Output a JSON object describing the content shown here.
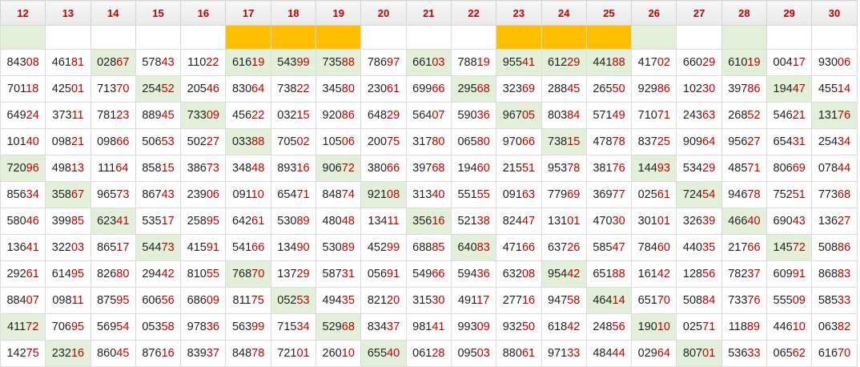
{
  "headers": [
    "12",
    "13",
    "14",
    "15",
    "16",
    "17",
    "18",
    "19",
    "20",
    "21",
    "22",
    "23",
    "24",
    "25",
    "26",
    "27",
    "28",
    "29",
    "30"
  ],
  "marker_row": [
    "green",
    "white",
    "white",
    "white",
    "white",
    "gold",
    "gold",
    "gold",
    "white",
    "white",
    "white",
    "gold",
    "gold",
    "gold",
    "green",
    "white",
    "green",
    "white",
    "white"
  ],
  "rows": [
    {
      "values": [
        "84308",
        "46181",
        "02867",
        "57843",
        "11022",
        "61619",
        "54399",
        "73588",
        "78697",
        "66103",
        "78819",
        "95541",
        "61229",
        "44188",
        "41702",
        "66029",
        "61019",
        "00417",
        "93006"
      ],
      "highlighted": [
        2,
        5,
        6,
        7,
        9,
        11,
        12,
        13,
        16
      ]
    },
    {
      "values": [
        "70118",
        "42501",
        "71370",
        "25452",
        "20546",
        "83064",
        "73822",
        "34580",
        "23061",
        "69966",
        "29568",
        "32369",
        "28845",
        "26550",
        "92986",
        "10230",
        "39786",
        "19447",
        "45514"
      ],
      "highlighted": [
        3,
        10,
        17
      ]
    },
    {
      "values": [
        "64924",
        "37311",
        "78123",
        "88945",
        "73309",
        "45622",
        "03215",
        "92086",
        "64829",
        "56407",
        "59036",
        "96705",
        "80384",
        "57149",
        "71071",
        "24363",
        "26852",
        "54621",
        "13176"
      ],
      "highlighted": [
        4,
        11,
        18
      ]
    },
    {
      "values": [
        "10140",
        "09821",
        "09866",
        "50653",
        "50227",
        "03388",
        "70502",
        "10506",
        "20075",
        "31780",
        "06580",
        "97066",
        "73815",
        "47878",
        "83725",
        "90964",
        "95627",
        "65431",
        "25434"
      ],
      "highlighted": [
        5,
        12
      ]
    },
    {
      "values": [
        "72096",
        "49813",
        "11164",
        "85815",
        "38673",
        "34848",
        "89316",
        "90672",
        "38066",
        "39768",
        "19460",
        "21551",
        "95378",
        "38176",
        "14493",
        "53429",
        "48571",
        "80669",
        "07844"
      ],
      "highlighted": [
        0,
        7,
        14
      ]
    },
    {
      "values": [
        "85634",
        "35867",
        "96573",
        "86743",
        "23906",
        "09110",
        "65471",
        "84874",
        "92108",
        "31340",
        "55155",
        "09163",
        "77969",
        "36977",
        "02561",
        "72454",
        "94678",
        "75251",
        "77368"
      ],
      "highlighted": [
        1,
        8,
        15
      ]
    },
    {
      "values": [
        "58046",
        "39985",
        "62341",
        "53517",
        "25895",
        "64261",
        "53089",
        "48048",
        "13411",
        "35616",
        "52138",
        "82447",
        "13101",
        "47030",
        "30101",
        "32639",
        "46640",
        "69043",
        "13627"
      ],
      "highlighted": [
        2,
        9,
        16
      ]
    },
    {
      "values": [
        "13641",
        "32203",
        "86517",
        "54473",
        "41591",
        "54166",
        "13490",
        "53089",
        "45299",
        "68885",
        "64083",
        "47166",
        "63726",
        "58547",
        "78460",
        "44035",
        "21766",
        "14572",
        "50886"
      ],
      "highlighted": [
        3,
        10,
        17
      ]
    },
    {
      "values": [
        "29261",
        "61495",
        "82680",
        "29442",
        "81055",
        "76870",
        "13729",
        "58731",
        "05691",
        "54966",
        "59436",
        "63208",
        "95442",
        "65188",
        "16142",
        "12856",
        "78237",
        "60991",
        "86883"
      ],
      "highlighted": [
        5,
        12
      ]
    },
    {
      "values": [
        "88407",
        "09811",
        "87595",
        "60656",
        "68609",
        "81175",
        "05253",
        "49435",
        "82120",
        "31530",
        "49117",
        "27716",
        "94758",
        "46414",
        "65170",
        "50884",
        "73376",
        "55509",
        "58533"
      ],
      "highlighted": [
        6,
        13
      ]
    },
    {
      "values": [
        "41172",
        "70695",
        "56954",
        "05358",
        "97836",
        "56399",
        "71534",
        "52968",
        "83437",
        "98141",
        "99309",
        "93250",
        "61842",
        "24856",
        "19010",
        "02571",
        "11889",
        "44610",
        "06382"
      ],
      "highlighted": [
        0,
        7,
        14
      ]
    },
    {
      "values": [
        "14275",
        "23216",
        "86045",
        "87616",
        "83937",
        "84878",
        "72101",
        "26010",
        "65540",
        "06128",
        "09503",
        "88061",
        "97133",
        "48444",
        "02964",
        "80701",
        "53633",
        "06562",
        "61670"
      ],
      "highlighted": [
        1,
        8,
        15
      ]
    }
  ]
}
